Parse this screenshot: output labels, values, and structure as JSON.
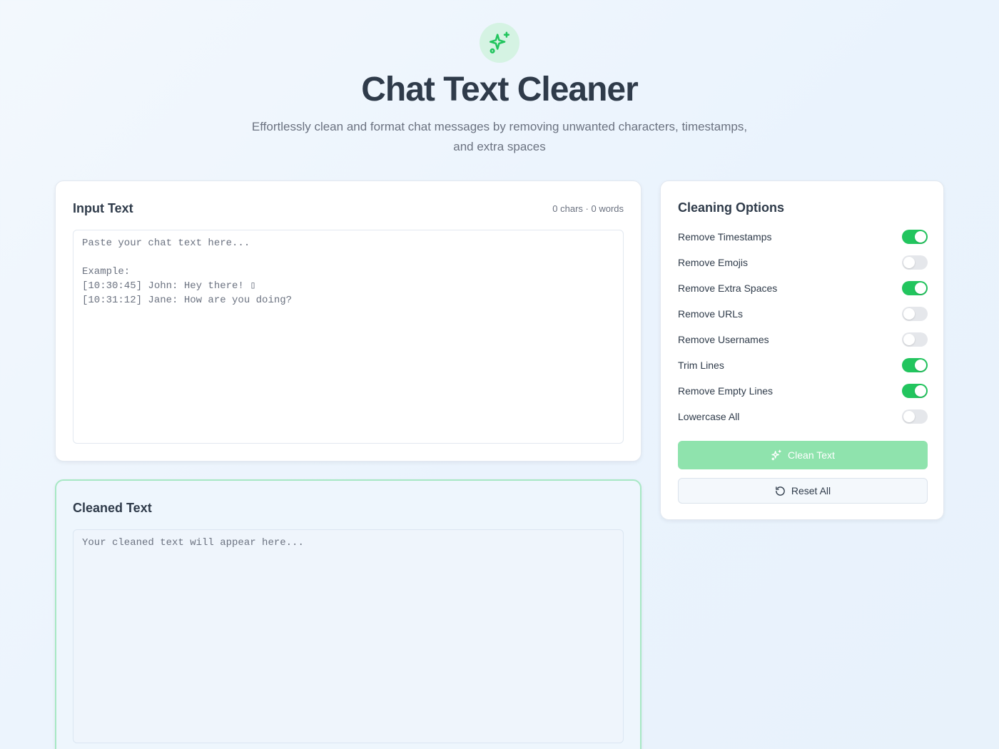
{
  "header": {
    "logo_icon": "sparkles-icon",
    "title": "Chat Text Cleaner",
    "subtitle": "Effortlessly clean and format chat messages by removing unwanted characters, timestamps, and extra spaces"
  },
  "input": {
    "title": "Input Text",
    "counter": "0 chars · 0 words",
    "placeholder": "Paste your chat text here...\n\nExample:\n[10:30:45] John: Hey there! ▯\n[10:31:12] Jane: How are you doing?"
  },
  "output": {
    "title": "Cleaned Text",
    "placeholder": "Your cleaned text will appear here..."
  },
  "options": {
    "title": "Cleaning Options",
    "items": [
      {
        "label": "Remove Timestamps",
        "enabled": true
      },
      {
        "label": "Remove Emojis",
        "enabled": false
      },
      {
        "label": "Remove Extra Spaces",
        "enabled": true
      },
      {
        "label": "Remove URLs",
        "enabled": false
      },
      {
        "label": "Remove Usernames",
        "enabled": false
      },
      {
        "label": "Trim Lines",
        "enabled": true
      },
      {
        "label": "Remove Empty Lines",
        "enabled": true
      },
      {
        "label": "Lowercase All",
        "enabled": false
      }
    ],
    "clean_button": "Clean Text",
    "reset_button": "Reset All"
  },
  "colors": {
    "accent": "#22c55e",
    "accent_disabled": "#8fe3ad",
    "title_text": "#2f3b4a"
  }
}
